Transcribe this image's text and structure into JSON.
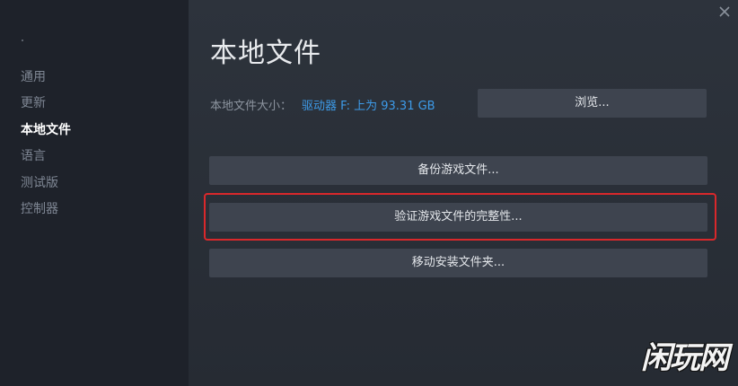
{
  "sidebar": {
    "items": [
      {
        "label": "通用",
        "active": false
      },
      {
        "label": "更新",
        "active": false
      },
      {
        "label": "本地文件",
        "active": true
      },
      {
        "label": "语言",
        "active": false
      },
      {
        "label": "测试版",
        "active": false
      },
      {
        "label": "控制器",
        "active": false
      }
    ]
  },
  "main": {
    "title": "本地文件",
    "size_label": "本地文件大小：",
    "size_value": "驱动器 F: 上为 93.31 GB",
    "browse_label": "浏览...",
    "backup_label": "备份游戏文件...",
    "verify_label": "验证游戏文件的完整性...",
    "move_label": "移动安装文件夹..."
  },
  "watermark": "闲玩网",
  "colors": {
    "accent_link": "#3d9be9",
    "highlight": "#d9282b",
    "button_bg": "#3e444f"
  },
  "icons": {
    "close": "close-icon"
  }
}
